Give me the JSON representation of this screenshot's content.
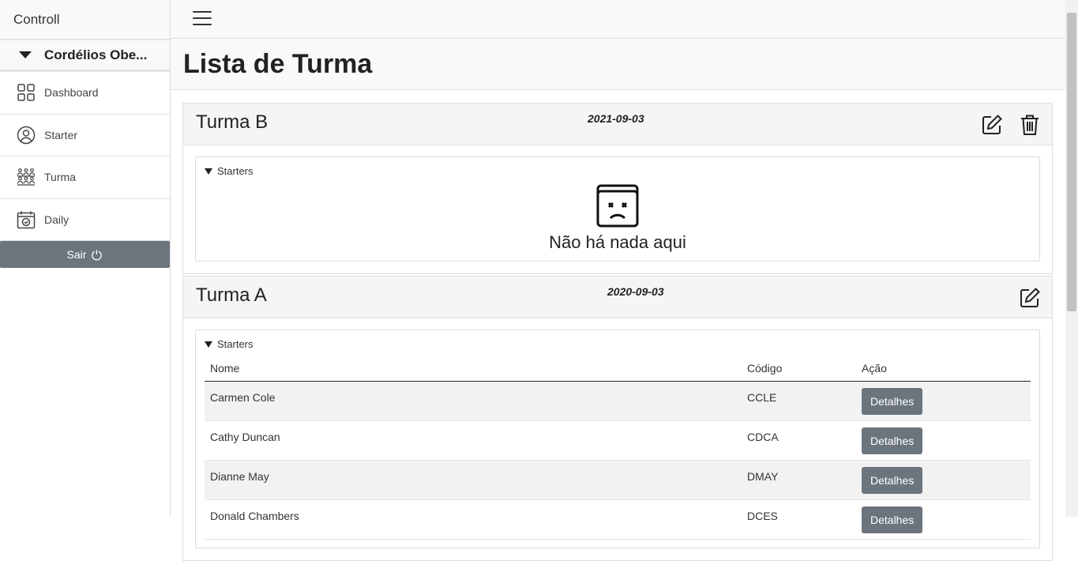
{
  "sidebar": {
    "brand": "Controll",
    "user_name": "Cordélios Obe...",
    "items": [
      {
        "label": "Dashboard",
        "icon": "grid-icon"
      },
      {
        "label": "Starter",
        "icon": "user-circle-icon"
      },
      {
        "label": "Turma",
        "icon": "group-icon"
      },
      {
        "label": "Daily",
        "icon": "calendar-check-icon"
      }
    ],
    "logout_label": "Sair"
  },
  "page": {
    "title": "Lista de Turma"
  },
  "cards": [
    {
      "title": "Turma B",
      "date": "2021-09-03",
      "summary": "Starters",
      "empty_text": "Não há nada aqui"
    },
    {
      "title": "Turma A",
      "date": "2020-09-03",
      "summary": "Starters",
      "table": {
        "headers": [
          "Nome",
          "Código",
          "Ação"
        ],
        "rows": [
          {
            "name": "Carmen Cole",
            "code": "CCLE",
            "action": "Detalhes"
          },
          {
            "name": "Cathy Duncan",
            "code": "CDCA",
            "action": "Detalhes"
          },
          {
            "name": "Dianne May",
            "code": "DMAY",
            "action": "Detalhes"
          },
          {
            "name": "Donald Chambers",
            "code": "DCES",
            "action": "Detalhes"
          }
        ]
      }
    }
  ]
}
